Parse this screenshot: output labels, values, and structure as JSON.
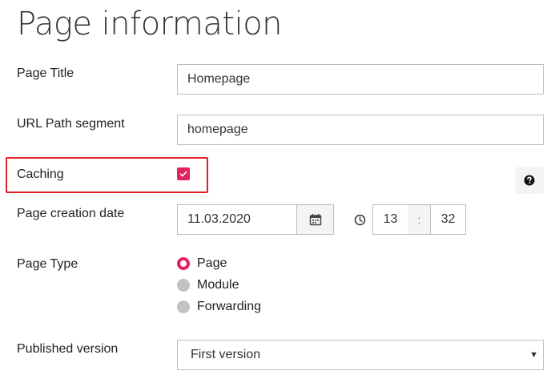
{
  "page": {
    "title": "Page information"
  },
  "form": {
    "page_title": {
      "label": "Page Title",
      "value": "Homepage"
    },
    "url_segment": {
      "label": "URL Path segment",
      "value": "homepage"
    },
    "caching": {
      "label": "Caching",
      "checked": true
    },
    "help": {
      "icon": "question-circle-icon"
    },
    "creation_date": {
      "label": "Page creation date",
      "date": "11.03.2020",
      "hours": "13",
      "separator": ":",
      "minutes": "32"
    },
    "page_type": {
      "label": "Page Type",
      "options": [
        "Page",
        "Module",
        "Forwarding"
      ],
      "selected": "Page"
    },
    "published_version": {
      "label": "Published version",
      "value": "First version"
    }
  },
  "colors": {
    "accent": "#e0245e",
    "highlight": "#e31e24",
    "border": "#bdbdbd"
  }
}
